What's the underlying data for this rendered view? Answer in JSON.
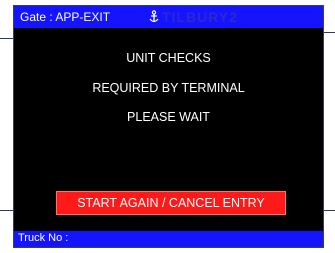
{
  "header": {
    "gate_label": "Gate : APP-EXIT",
    "logo_text": "TILBURY2"
  },
  "messages": {
    "line1": "UNIT CHECKS",
    "line2": "REQUIRED BY TERMINAL",
    "line3": "PLEASE WAIT"
  },
  "actions": {
    "cancel_label": "START AGAIN / CANCEL ENTRY"
  },
  "footer": {
    "truck_label": "Truck No :"
  },
  "colors": {
    "bar_blue": "#1414ff",
    "screen_bg": "#000000",
    "cancel_red": "#ff1a1a",
    "text": "#ffffff"
  }
}
